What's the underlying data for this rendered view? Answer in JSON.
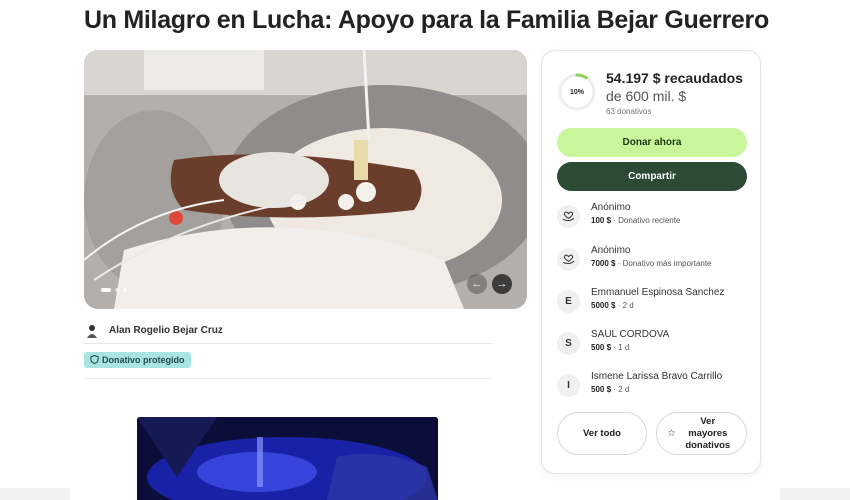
{
  "page": {
    "title": "Un Milagro en Lucha: Apoyo para la Familia Bejar Guerrero"
  },
  "organizer": {
    "name": "Alan Rogelio Bejar Cruz"
  },
  "badge": {
    "label": "Donativo protegido"
  },
  "carousel": {
    "slides": 3,
    "active_slide": 1
  },
  "fundraiser": {
    "progress_label": "10%",
    "progress_fraction": 0.0903,
    "raised": "54.197 $ recaudados",
    "goal": "de 600 mil. $",
    "donations_count": "63 donativos",
    "donate_label": "Donar ahora",
    "share_label": "Compartir"
  },
  "donations": [
    {
      "initial": "",
      "icon": "heart-hand-icon",
      "name": "Anónimo",
      "amount": "100 $",
      "detail": "Donativo reciente"
    },
    {
      "initial": "",
      "icon": "heart-hand-icon",
      "name": "Anónimo",
      "amount": "7000 $",
      "detail": "Donativo más importante"
    },
    {
      "initial": "E",
      "name": "Emmanuel Espinosa Sanchez",
      "amount": "5000 $",
      "detail": "2 d"
    },
    {
      "initial": "S",
      "name": "SAUL CORDOVA",
      "amount": "500 $",
      "detail": "1 d"
    },
    {
      "initial": "I",
      "name": "Ismene Larissa Bravo Carrillo",
      "amount": "500 $",
      "detail": "2 d"
    }
  ],
  "actions": {
    "see_all": "Ver todo",
    "see_top": "Ver mayores donativos"
  },
  "colors": {
    "donate_button": "#c9f59b",
    "share_button": "#2d4a35",
    "progress": "#8fd35a",
    "badge": "#a9e4e0"
  }
}
